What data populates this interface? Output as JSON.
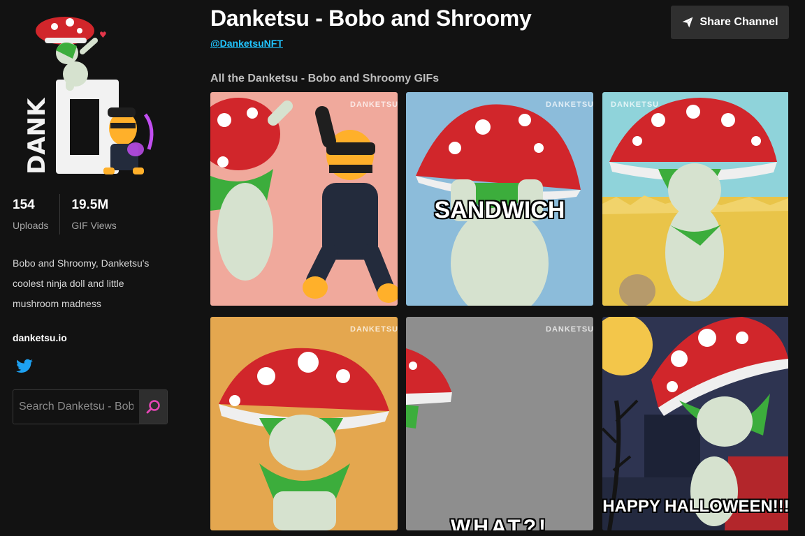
{
  "channel": {
    "title": "Danketsu - Bobo and Shroomy",
    "handle": "@DanketsuNFT"
  },
  "header": {
    "share_label": "Share Channel"
  },
  "sidebar": {
    "avatar_text": "DANK",
    "stats": [
      {
        "value": "154",
        "label": "Uploads"
      },
      {
        "value": "19.5M",
        "label": "GIF Views"
      }
    ],
    "description": "Bobo and Shroomy, Danketsu's coolest ninja doll and little mushroom madness",
    "website": "danketsu.io",
    "search_placeholder": "Search Danketsu - Bobo and Shroomy"
  },
  "section_title": "All the Danketsu - Bobo and Shroomy GIFs",
  "gifs": [
    {
      "bg": "#f0a99c",
      "watermark": "DANKETSU",
      "caption": ""
    },
    {
      "bg": "#8cbcda",
      "watermark": "DANKETSU",
      "caption": "SANDWICH"
    },
    {
      "bg": "#8fd3da",
      "watermark": "DANKETSU",
      "caption": ""
    },
    {
      "bg": "#e4a74f",
      "watermark": "DANKETSU",
      "caption": ""
    },
    {
      "bg": "#8e8e8e",
      "watermark": "DANKETSU",
      "caption": "WHAT?!"
    },
    {
      "bg": "#2e3451",
      "watermark": "",
      "caption": "HAPPY HALLOWEEN!!!"
    }
  ],
  "colors": {
    "accent_cyan": "#21c5ff",
    "search_icon": "#e646b6",
    "twitter": "#1da1f2",
    "mushroom_red": "#d1262b"
  }
}
